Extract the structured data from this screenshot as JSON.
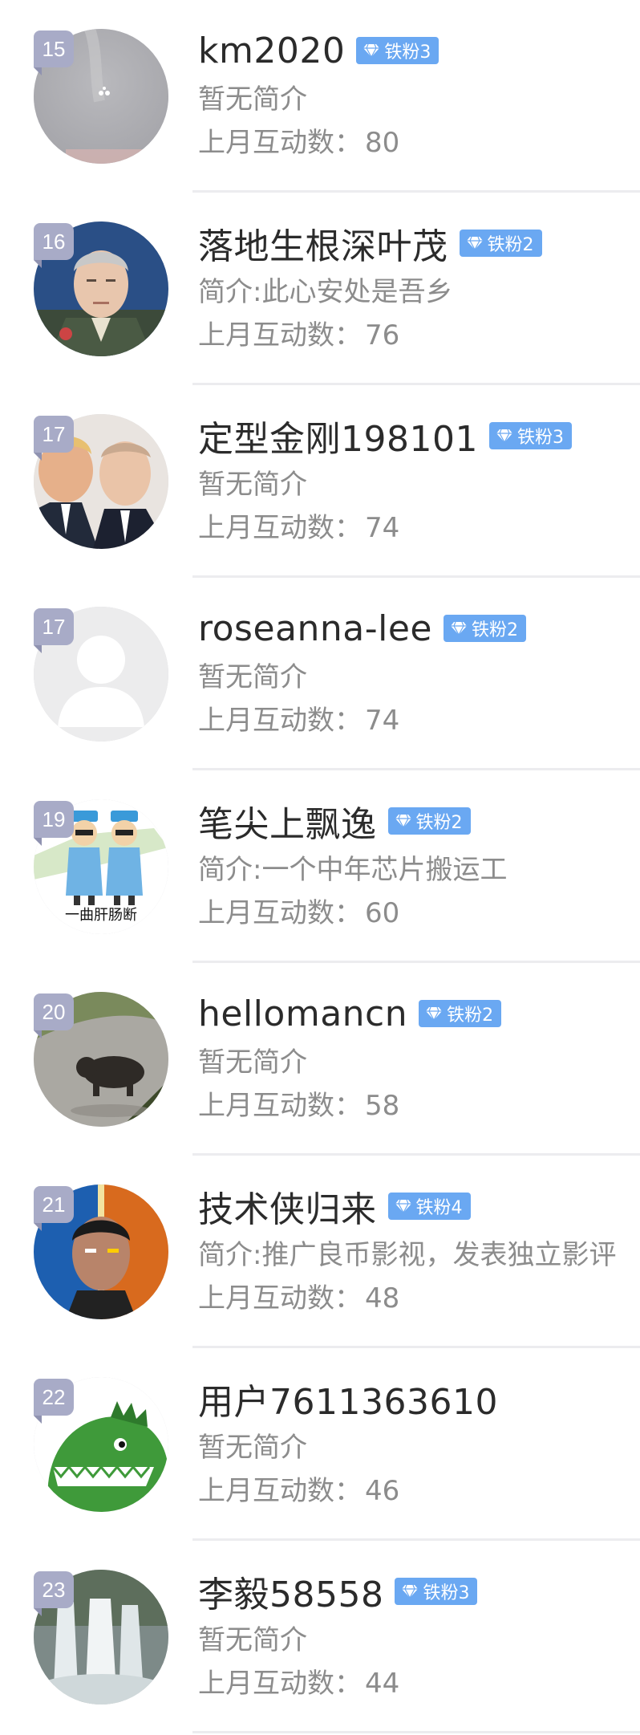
{
  "interaction_label": "上月互动数：",
  "colors": {
    "badge": "#6aa8f2",
    "rank": "#a8abc7",
    "name": "#2b2b2b",
    "secondary": "#8c8c8c"
  },
  "fans": [
    {
      "rank": "15",
      "name": "km2020",
      "badge": "铁粉3",
      "bio": "暂无简介",
      "count": "80",
      "avatar": "blurred-gray-photo"
    },
    {
      "rank": "16",
      "name": "落地生根深叶茂",
      "badge": "铁粉2",
      "bio": "简介:此心安处是吾乡",
      "count": "76",
      "avatar": "portrait-military-officer"
    },
    {
      "rank": "17",
      "name": "定型金刚198101",
      "badge": "铁粉3",
      "bio": "暂无简介",
      "count": "74",
      "avatar": "two-men-portrait"
    },
    {
      "rank": "17",
      "name": "roseanna-lee",
      "badge": "铁粉2",
      "bio": "暂无简介",
      "count": "74",
      "avatar": "default-user-silhouette"
    },
    {
      "rank": "19",
      "name": "笔尖上飘逸",
      "badge": "铁粉2",
      "bio": "简介:一个中年芯片搬运工",
      "count": "60",
      "avatar": "cartoon-two-men-caption",
      "avatar_caption": "一曲肝肠断"
    },
    {
      "rank": "20",
      "name": "hellomancn",
      "badge": "铁粉2",
      "bio": "暂无简介",
      "count": "58",
      "avatar": "bear-on-road-photo"
    },
    {
      "rank": "21",
      "name": "技术侠归来",
      "badge": "铁粉4",
      "bio": "简介:推广良币影视，发表独立影评",
      "count": "48",
      "avatar": "fire-ice-face-poster"
    },
    {
      "rank": "22",
      "name": "用户7611363610",
      "badge": "",
      "bio": "暂无简介",
      "count": "46",
      "avatar": "green-dinosaur-cartoon"
    },
    {
      "rank": "23",
      "name": "李毅58558",
      "badge": "铁粉3",
      "bio": "暂无简介",
      "count": "44",
      "avatar": "waterfall-photo"
    }
  ]
}
